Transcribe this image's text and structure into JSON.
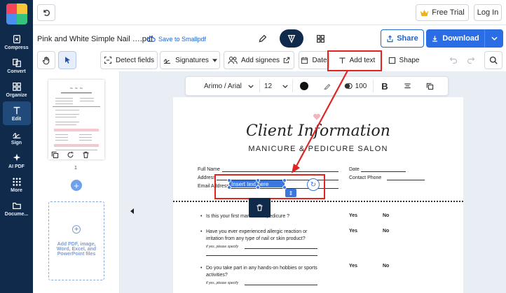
{
  "sidebar": {
    "items": [
      {
        "label": "Compress",
        "icon": "compress-icon"
      },
      {
        "label": "Convert",
        "icon": "convert-icon"
      },
      {
        "label": "Organize",
        "icon": "organize-icon"
      },
      {
        "label": "Edit",
        "icon": "text-edit-icon",
        "active": true
      },
      {
        "label": "Sign",
        "icon": "sign-icon"
      },
      {
        "label": "AI PDF",
        "icon": "sparkle-icon"
      },
      {
        "label": "More",
        "icon": "grid-icon"
      },
      {
        "label": "Docume...",
        "icon": "folder-icon"
      }
    ]
  },
  "header": {
    "free_trial": "Free Trial",
    "login": "Log In"
  },
  "titlebar": {
    "doc_title": "Pink and White Simple Nail ….pdf",
    "save_to": "Save to Smallpdf",
    "share": "Share",
    "download": "Download"
  },
  "toolbar": {
    "detect_fields": "Detect fields",
    "signatures": "Signatures",
    "add_signees": "Add signees",
    "date": "Date",
    "add_text": "Add text",
    "shape": "Shape"
  },
  "format_bar": {
    "font": "Arimo / Arial",
    "size": "12",
    "opacity": "100",
    "bold": "B"
  },
  "thumbnails": {
    "page_number": "1",
    "add_files": "Add PDF, image, Word, Excel, and PowerPoint files"
  },
  "document": {
    "title": "Client Information",
    "subtitle": "MANICURE & PEDICURE SALON",
    "fields": {
      "full_name": "Full Name",
      "address": "Address",
      "email": "Email Address",
      "date": "Date",
      "contact": "Contact Phone"
    },
    "inserted_text": "Insert text here",
    "questions": [
      {
        "text": "Is this your first manicure & pedicure ?",
        "yes": "Yes",
        "no": "No"
      },
      {
        "text": "Have you ever experienced allergic reaction or irritation from any type of nail or skin product?",
        "yes": "Yes",
        "no": "No",
        "followup": "if yes, please specify"
      },
      {
        "text": "Do you take part in any hands-on hobbies or sports activities?",
        "yes": "Yes",
        "no": "No",
        "followup": "if yes, please specify"
      }
    ]
  },
  "colors": {
    "sidebar": "#0f2a4a",
    "accent": "#2165d1",
    "download": "#2b6de5",
    "highlight": "#e02424",
    "selection": "#3a78e0"
  }
}
